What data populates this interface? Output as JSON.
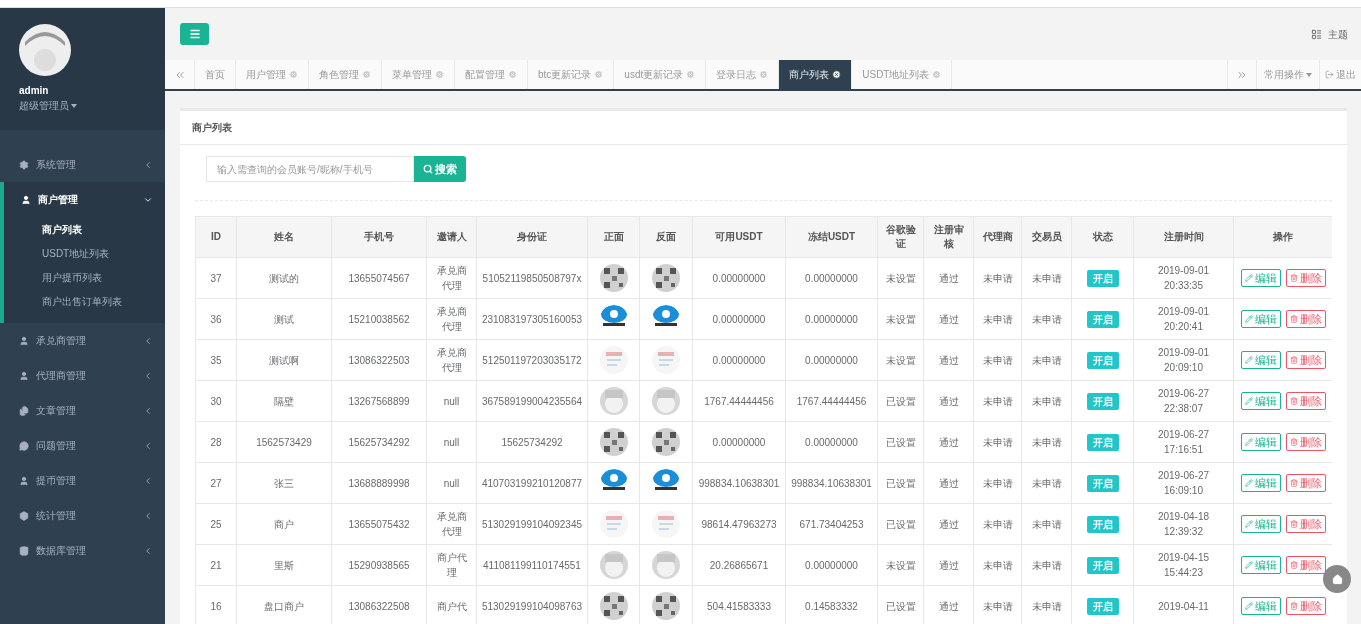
{
  "user": {
    "name": "admin",
    "role": "超级管理员"
  },
  "sidebar": {
    "items": [
      {
        "label": "系统管理",
        "expanded": false
      },
      {
        "label": "商户管理",
        "expanded": true,
        "children": [
          {
            "label": "商户列表",
            "selected": true
          },
          {
            "label": "USDT地址列表",
            "selected": false
          },
          {
            "label": "用户提币列表",
            "selected": false
          },
          {
            "label": "商户出售订单列表",
            "selected": false
          }
        ]
      },
      {
        "label": "承兑商管理",
        "expanded": false
      },
      {
        "label": "代理商管理",
        "expanded": false
      },
      {
        "label": "文章管理",
        "expanded": false
      },
      {
        "label": "问题管理",
        "expanded": false
      },
      {
        "label": "提币管理",
        "expanded": false
      },
      {
        "label": "统计管理",
        "expanded": false
      },
      {
        "label": "数据库管理",
        "expanded": false
      }
    ]
  },
  "header": {
    "theme": "主题"
  },
  "tabs": [
    {
      "label": "首页",
      "selected": false,
      "closable": false
    },
    {
      "label": "用户管理",
      "selected": false,
      "closable": true
    },
    {
      "label": "角色管理",
      "selected": false,
      "closable": true
    },
    {
      "label": "菜单管理",
      "selected": false,
      "closable": true
    },
    {
      "label": "配置管理",
      "selected": false,
      "closable": true
    },
    {
      "label": "btc更新记录",
      "selected": false,
      "closable": true
    },
    {
      "label": "usdt更新记录",
      "selected": false,
      "closable": true
    },
    {
      "label": "登录日志",
      "selected": false,
      "closable": true
    },
    {
      "label": "商户列表",
      "selected": true,
      "closable": true
    },
    {
      "label": "USDT地址列表",
      "selected": false,
      "closable": true
    }
  ],
  "tab_actions": {
    "menu": "常用操作",
    "logout": "退出"
  },
  "panel": {
    "title": "商户列表",
    "search": {
      "placeholder": "输入需查询的会员账号/昵称/手机号",
      "button": "搜索"
    }
  },
  "table": {
    "columns": [
      "ID",
      "姓名",
      "手机号",
      "邀请人",
      "身份证",
      "正面",
      "反面",
      "可用USDT",
      "冻结USDT",
      "谷歌验证",
      "注册审核",
      "代理商",
      "交易员",
      "状态",
      "注册时间",
      "操作"
    ],
    "rows": [
      {
        "id": "37",
        "name": "测试的",
        "phone": "13655074567",
        "inviter": "承兑商代理",
        "id_card": "51052119850508797x",
        "usdt": "0.00000000",
        "frozen": "0.00000000",
        "google": "未设置",
        "review": "通过",
        "agent": "未申请",
        "trader": "未申请",
        "status": {
          "label": "开启",
          "on": true
        },
        "date": "2019-09-01",
        "time": "20:33:35",
        "edit": "编辑",
        "delete": "删除"
      },
      {
        "id": "36",
        "name": "测试",
        "phone": "15210038562",
        "inviter": "承兑商代理",
        "id_card": "231083197305160053",
        "usdt": "0.00000000",
        "frozen": "0.00000000",
        "google": "未设置",
        "review": "通过",
        "agent": "未申请",
        "trader": "未申请",
        "status": {
          "label": "开启",
          "on": true
        },
        "date": "2019-09-01",
        "time": "20:20:41",
        "edit": "编辑",
        "delete": "删除"
      },
      {
        "id": "35",
        "name": "测试啊",
        "phone": "13086322503",
        "inviter": "承兑商代理",
        "id_card": "512501197203035172",
        "usdt": "0.00000000",
        "frozen": "0.00000000",
        "google": "未设置",
        "review": "通过",
        "agent": "未申请",
        "trader": "未申请",
        "status": {
          "label": "开启",
          "on": true
        },
        "date": "2019-09-01",
        "time": "20:09:10",
        "edit": "编辑",
        "delete": "删除"
      },
      {
        "id": "30",
        "name": "隔壁",
        "phone": "13267568899",
        "inviter": "null",
        "id_card": "367589199004235564",
        "usdt": "1767.44444456",
        "frozen": "1767.44444456",
        "google": "已设置",
        "review": "通过",
        "agent": "未申请",
        "trader": "未申请",
        "status": {
          "label": "开启",
          "on": true
        },
        "date": "2019-06-27",
        "time": "22:38:07",
        "edit": "编辑",
        "delete": "删除"
      },
      {
        "id": "28",
        "name": "1562573429",
        "phone": "15625734292",
        "inviter": "null",
        "id_card": "15625734292",
        "usdt": "0.00000000",
        "frozen": "0.00000000",
        "google": "已设置",
        "review": "通过",
        "agent": "未申请",
        "trader": "未申请",
        "status": {
          "label": "开启",
          "on": true
        },
        "date": "2019-06-27",
        "time": "17:16:51",
        "edit": "编辑",
        "delete": "删除"
      },
      {
        "id": "27",
        "name": "张三",
        "phone": "13688889998",
        "inviter": "null",
        "id_card": "410703199210120877",
        "usdt": "998834.10638301",
        "frozen": "998834.10638301",
        "google": "已设置",
        "review": "通过",
        "agent": "未申请",
        "trader": "未申请",
        "status": {
          "label": "开启",
          "on": true
        },
        "date": "2019-06-27",
        "time": "16:09:10",
        "edit": "编辑",
        "delete": "删除"
      },
      {
        "id": "25",
        "name": "商户",
        "phone": "13655075432",
        "inviter": "承兑商代理",
        "id_card": "513029199104092345",
        "usdt": "98614.47963273",
        "frozen": "671.73404253",
        "google": "已设置",
        "review": "通过",
        "agent": "未申请",
        "trader": "未申请",
        "status": {
          "label": "开启",
          "on": true
        },
        "date": "2019-04-18",
        "time": "12:39:32",
        "edit": "编辑",
        "delete": "删除"
      },
      {
        "id": "21",
        "name": "里斯",
        "phone": "15290938565",
        "inviter": "商户代理",
        "id_card": "411081199110174551",
        "usdt": "20.26865671",
        "frozen": "0.00000000",
        "google": "未设置",
        "review": "通过",
        "agent": "未申请",
        "trader": "未申请",
        "status": {
          "label": "开启",
          "on": true
        },
        "date": "2019-04-15",
        "time": "15:44:23",
        "edit": "编辑",
        "delete": "删除"
      },
      {
        "id": "16",
        "name": "盘口商户",
        "phone": "13086322508",
        "inviter": "商户代",
        "id_card": "513029199104098763",
        "usdt": "504.41583333",
        "frozen": "0.14583332",
        "google": "已设置",
        "review": "通过",
        "agent": "未申请",
        "trader": "未申请",
        "status": {
          "label": "开启",
          "on": true
        },
        "date": "2019-04-11",
        "edit": "编辑",
        "delete": "删除"
      }
    ]
  }
}
